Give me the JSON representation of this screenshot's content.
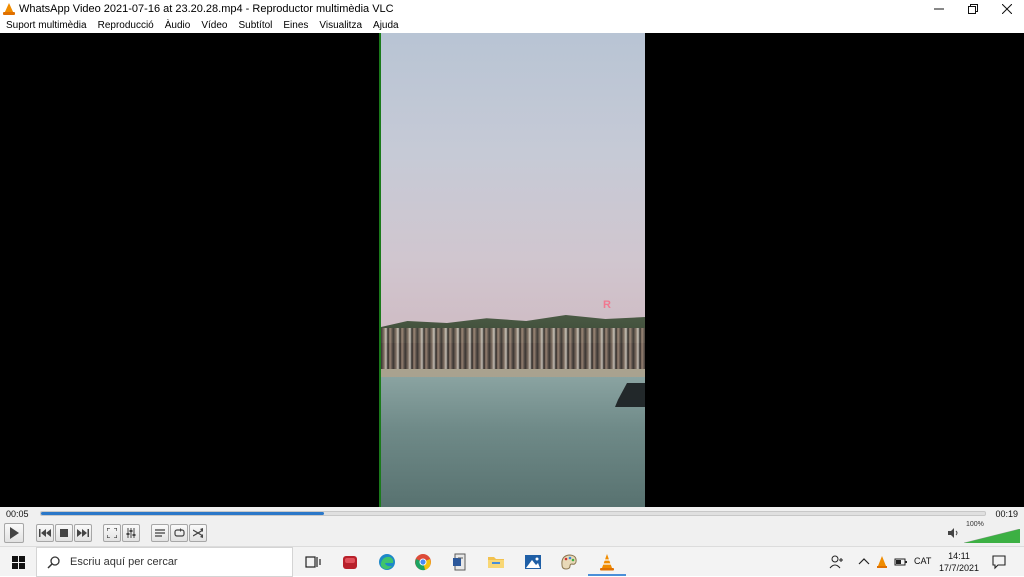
{
  "window": {
    "title": "WhatsApp Video 2021-07-16 at 23.20.28.mp4 - Reproductor multimèdia VLC",
    "controls": {
      "minimize": "—",
      "restore": "❐",
      "close": "✕"
    }
  },
  "menu": {
    "items": [
      "Suport multimèdia",
      "Reproducció",
      "Àudio",
      "Vídeo",
      "Subtítol",
      "Eines",
      "Visualitza",
      "Ajuda"
    ]
  },
  "player": {
    "elapsed": "00:05",
    "total": "00:19",
    "progress_fraction": 0.3,
    "volume_label": "100%",
    "volume_fraction": 1.0
  },
  "taskbar": {
    "search_placeholder": "Escriu aquí per cercar",
    "language": "CAT",
    "time": "14:11",
    "date": "17/7/2021",
    "pinned_icons": [
      "task-view-icon",
      "app-red-icon",
      "edge-icon",
      "chrome-icon",
      "office-icon",
      "file-explorer-icon",
      "photos-icon",
      "paint-icon",
      "vlc-icon"
    ]
  },
  "colors": {
    "seek_fill": "#2b78c9",
    "vlc_orange": "#f08c00",
    "volume_green": "#3cb043"
  }
}
